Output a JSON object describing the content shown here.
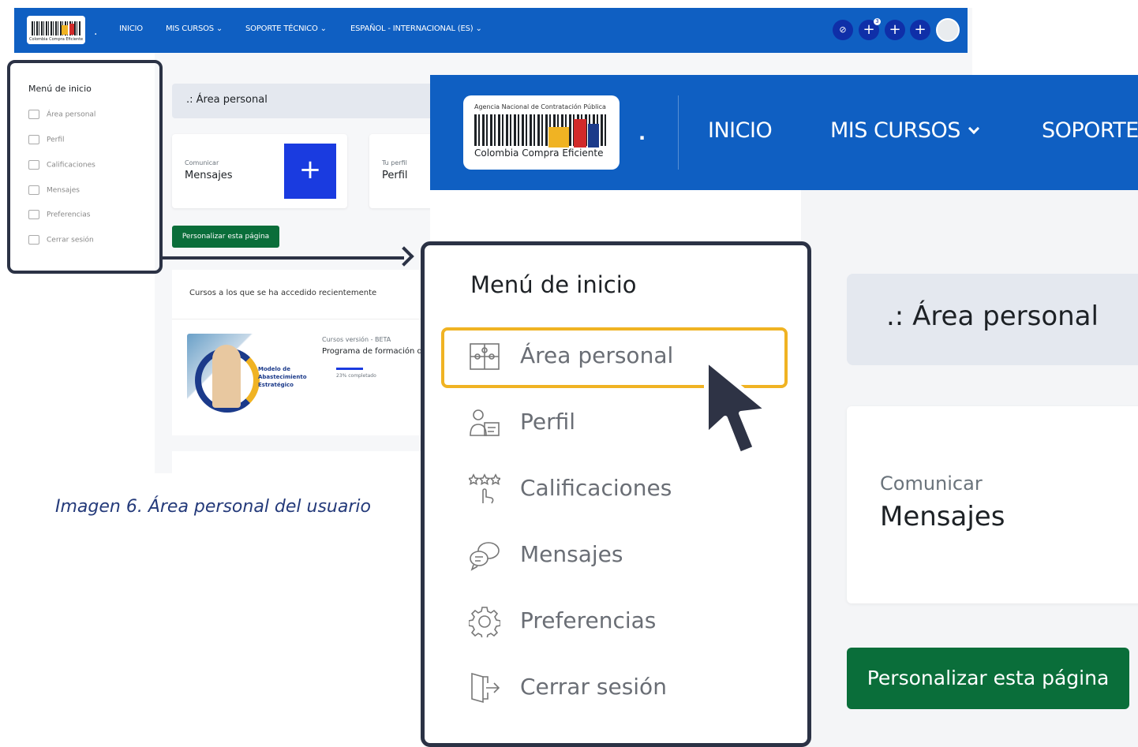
{
  "small_screenshot": {
    "nav": {
      "inicio": "INICIO",
      "mis_cursos": "MIS CURSOS ⌄",
      "soporte": "SOPORTE TÉCNICO ⌄",
      "idioma": "ESPAÑOL - INTERNACIONAL (ES) ⌄"
    },
    "notification_count": "3",
    "logo_text": "Colombia Compra Eficiente",
    "sidebar": {
      "title": "Menú de inicio",
      "items": [
        "Área personal",
        "Perfil",
        "Calificaciones",
        "Mensajes",
        "Preferencias",
        "Cerrar sesión"
      ]
    },
    "breadcrumb": ".: Área personal",
    "card_mensajes": {
      "caption": "Comunicar",
      "title": "Mensajes"
    },
    "card_perfil": {
      "caption": "Tu perfil",
      "title": "Perfil"
    },
    "customize_button": "Personalizar esta página",
    "recent_title": "Cursos a los que se ha accedido recientemente",
    "course": {
      "thumb_text": "Modelo de\nAbastecimiento\nEstratégico",
      "caption": "Cursos versión - BETA",
      "title": "Programa de formación de",
      "progress_label": "23% completado",
      "progress_pct": 23
    }
  },
  "caption": "Imagen 6. Área personal del usuario",
  "zoom": {
    "logo_top": "Agencia Nacional de Contratación Pública",
    "logo_text": "Colombia Compra Eficiente",
    "nav": {
      "inicio": "INICIO",
      "mis_cursos": "MIS CURSOS",
      "soporte": "SOPORTE"
    },
    "breadcrumb": ".: Área personal",
    "card": {
      "caption": "Comunicar",
      "title": "Mensajes"
    },
    "customize_button": "Personalizar esta página",
    "menu": {
      "title": "Menú de inicio",
      "items": [
        {
          "label": "Área personal",
          "icon": "puzzle-icon"
        },
        {
          "label": "Perfil",
          "icon": "profile-icon"
        },
        {
          "label": "Calificaciones",
          "icon": "ratings-icon"
        },
        {
          "label": "Mensajes",
          "icon": "messages-icon"
        },
        {
          "label": "Preferencias",
          "icon": "gear-icon"
        },
        {
          "label": "Cerrar sesión",
          "icon": "logout-icon"
        }
      ]
    }
  },
  "colors": {
    "topbar": "#0f5fc2",
    "green": "#0a6e3a",
    "highlight": "#f0b323",
    "frame": "#2b3245",
    "accent_blue": "#1a3be0"
  }
}
